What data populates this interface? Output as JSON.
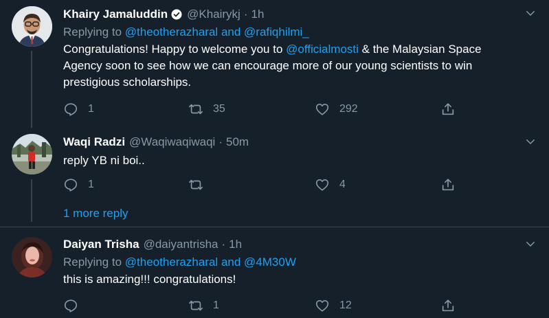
{
  "tweets": [
    {
      "name": "Khairy Jamaluddin",
      "handle": "@Khairykj",
      "time": "1h",
      "replying_prefix": "Replying to",
      "replying_to_1": "@theotherazharal",
      "replying_and": "and",
      "replying_to_2": "@rafiqhilmi_",
      "text_1": "Congratulations! Happy to welcome you to",
      "text_mention": "@officialmosti",
      "text_2": "& the Malaysian Space Agency soon to see how we can encourage more of our young scientists to win prestigious scholarships.",
      "replies": "1",
      "retweets": "35",
      "likes": "292"
    },
    {
      "name": "Waqi Radzi",
      "handle": "@Waqiwaqiwaqi",
      "time": "50m",
      "text": "reply YB ni boi..",
      "replies": "1",
      "retweets": "",
      "likes": "4"
    },
    {
      "name": "Daiyan Trisha",
      "handle": "@daiyantrisha",
      "time": "1h",
      "replying_prefix": "Replying to",
      "replying_to_1": "@theotherazharal",
      "replying_and": "and",
      "replying_to_2": "@4M30W",
      "text": "this is amazing!!! congratulations!",
      "replies": "",
      "retweets": "1",
      "likes": "12"
    }
  ],
  "more_reply": "1 more reply",
  "separator": "·",
  "colors": {
    "background": "#15202b",
    "secondary_text": "#8899a6",
    "link": "#1da1f2",
    "divider": "#38444d"
  },
  "icons": [
    "verified-badge-icon",
    "chevron-down-icon",
    "reply-icon",
    "retweet-icon",
    "like-icon",
    "share-icon"
  ]
}
